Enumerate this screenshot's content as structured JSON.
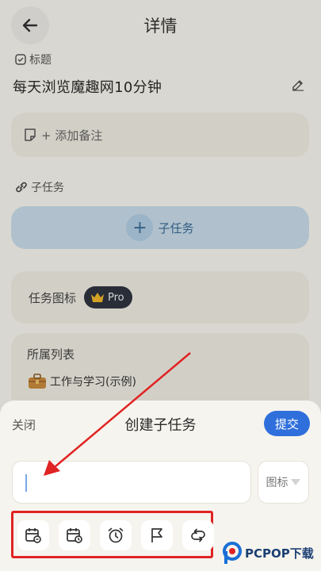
{
  "header": {
    "title": "详情"
  },
  "title_section": {
    "label": "标题",
    "value": "每天浏览魔趣网10分钟"
  },
  "note": {
    "label": "+ 添加备注"
  },
  "subtask_section": {
    "label": "子任务",
    "add_label": "子任务"
  },
  "task_icon": {
    "label": "任务图标",
    "badge": "Pro"
  },
  "list_section": {
    "label": "所属列表",
    "value": "工作与学习(示例)"
  },
  "sheet": {
    "close_label": "关闭",
    "title": "创建子任务",
    "submit_label": "提交",
    "icon_select_label": "图标",
    "toolbar_icons": [
      "calendar-start-icon",
      "calendar-due-icon",
      "alarm-clock-icon",
      "flag-icon",
      "repeat-icon"
    ]
  },
  "watermark": {
    "text": "PCPOP下载"
  },
  "colors": {
    "accent": "#2f6fdc",
    "highlight": "#e02323",
    "subtask_bg": "#c9dcea"
  }
}
